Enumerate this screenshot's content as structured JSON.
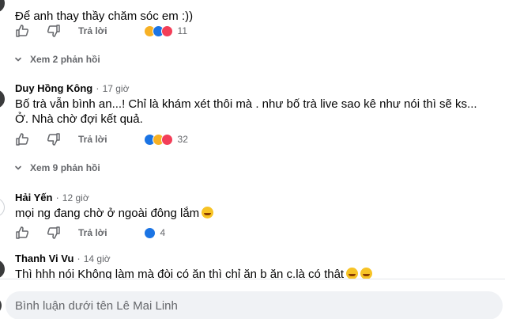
{
  "comments": [
    {
      "name": "",
      "time": "",
      "text": "Để anh thay thầy chăm sóc em :))",
      "reply_label": "Trả lời",
      "react_count": "11",
      "reactions": [
        "haha",
        "like",
        "love"
      ]
    },
    {
      "name": "Duy Hồng Kông",
      "time": "17 giờ",
      "text_line1": "Bố trà vẫn bình an...! Chỉ là khám xét thôi mà . như bố trà live sao kê như nói thì sẽ ks...",
      "text_line2": "Ở. Nhà chờ đợi kết quả.",
      "reply_label": "Trả lời",
      "react_count": "32",
      "reactions": [
        "like",
        "haha",
        "love"
      ]
    },
    {
      "name": "Hải Yến",
      "time": "12 giờ",
      "text": "mọi ng đang chờ ở ngoài đông lắm",
      "reply_label": "Trả lời",
      "react_count": "4",
      "reactions": [
        "like"
      ]
    },
    {
      "name": "Thanh Vi Vu",
      "time": "14 giờ",
      "text": "Thì hhh nói Không làm mà đòi có ăn thì chỉ ăn b ăn c.là có thật"
    }
  ],
  "view_replies": [
    "Xem 2 phản hồi",
    "Xem 9 phản hồi"
  ],
  "composer": {
    "placeholder": "Bình luận dưới tên Lê Mai Linh"
  },
  "colors": {
    "secondary_text": "#65676b",
    "like_blue": "#1b74e4",
    "love_red": "#f33e58",
    "haha_yellow": "#f7b125",
    "input_bg": "#f0f2f5"
  },
  "icons": {
    "like": "thumbs-up-icon",
    "dislike": "thumbs-down-icon",
    "expand": "chevron-down-icon"
  }
}
